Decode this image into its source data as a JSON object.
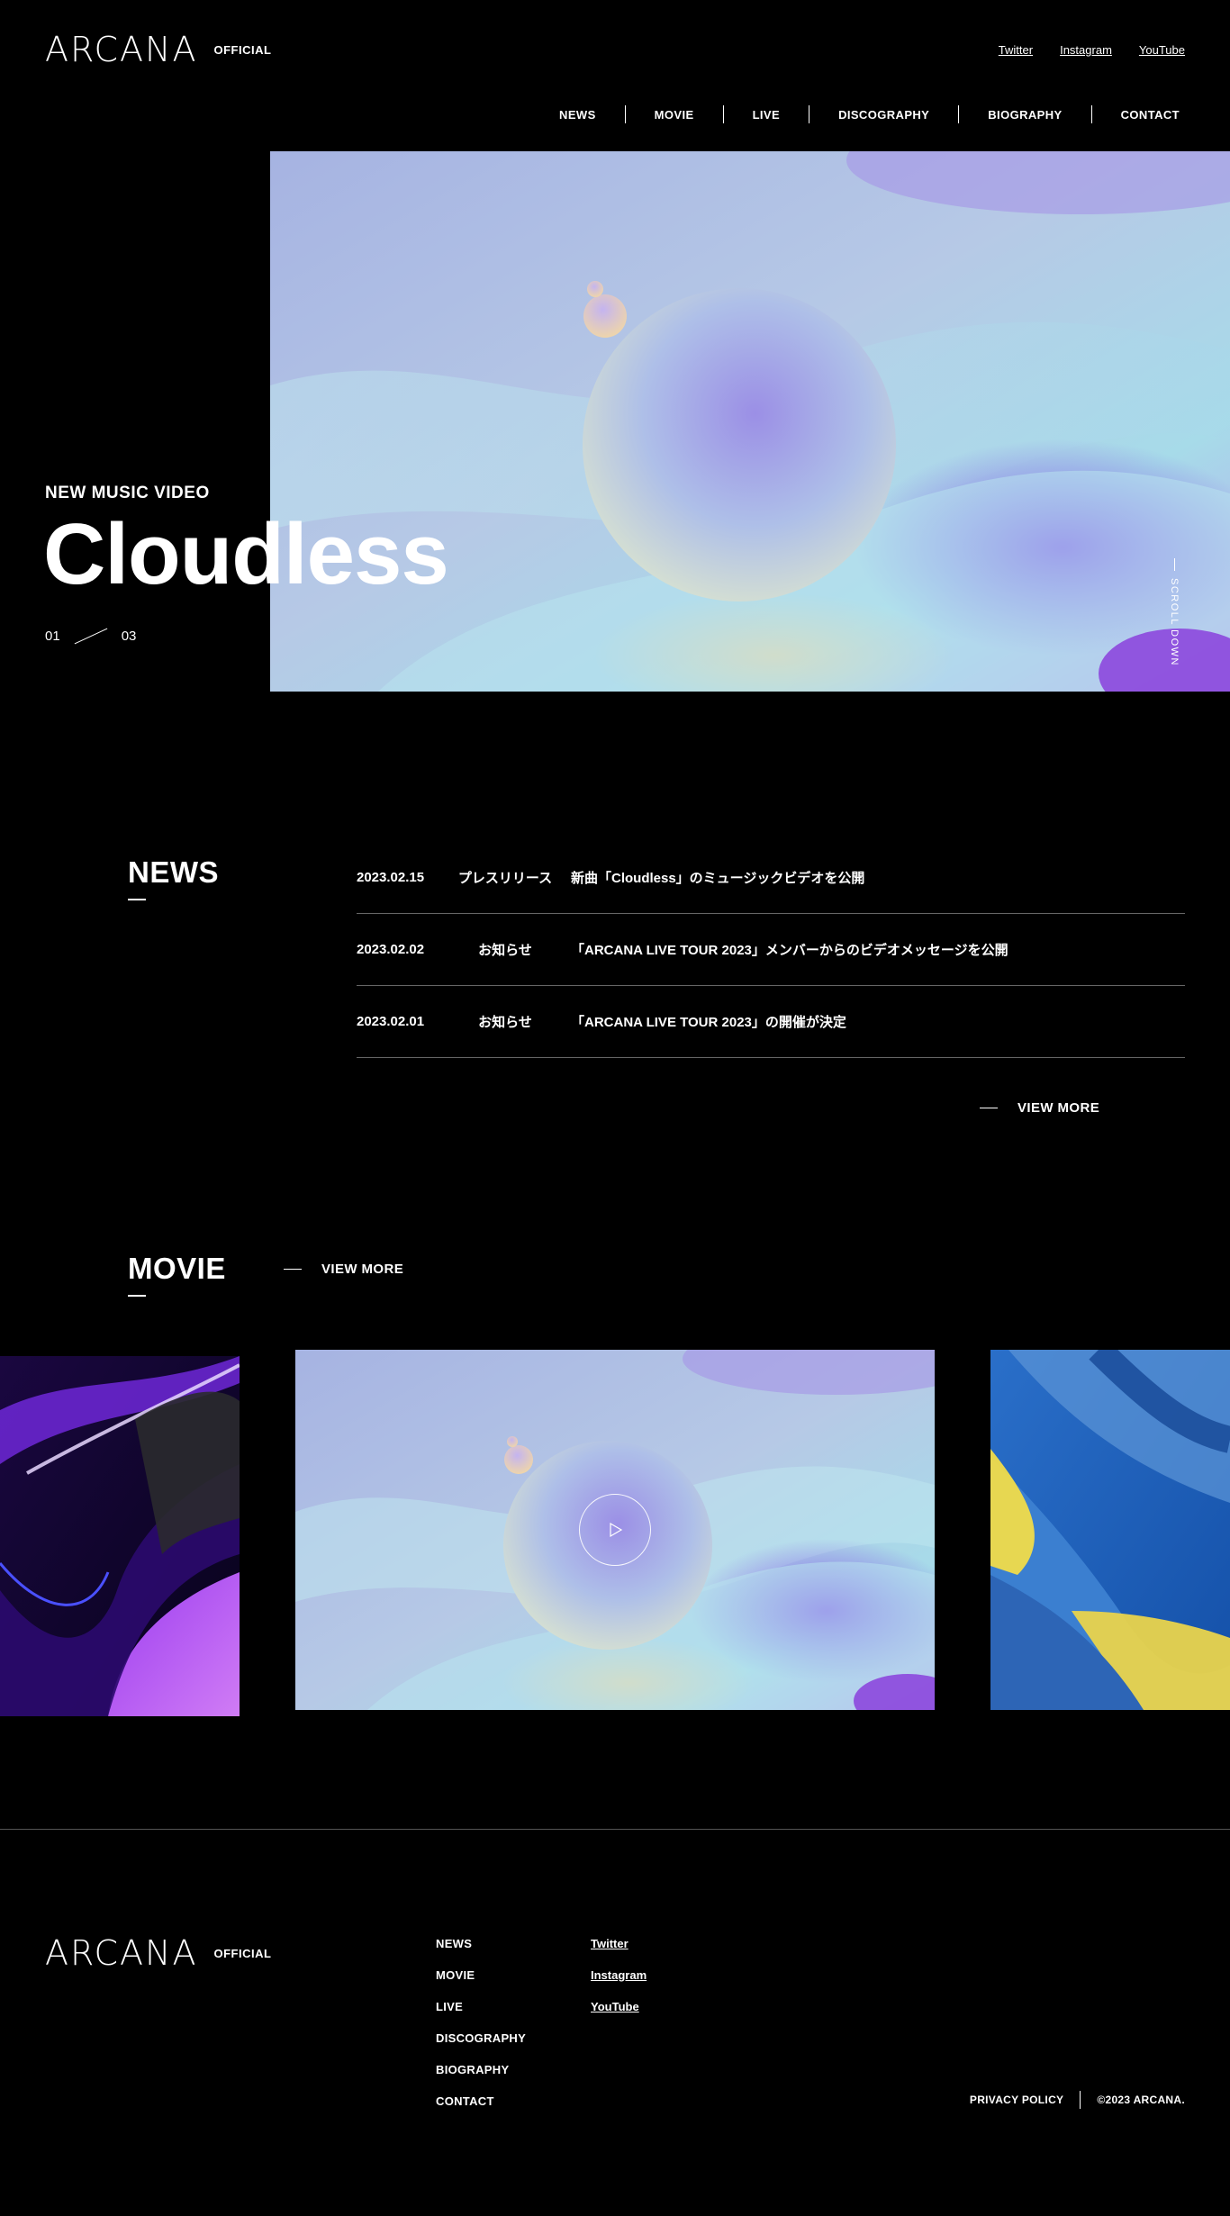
{
  "header": {
    "logo": "ARCANA",
    "logo_tag": "OFFICIAL",
    "social": [
      "Twitter",
      "Instagram",
      "YouTube"
    ],
    "nav": [
      "NEWS",
      "MOVIE",
      "LIVE",
      "DISCOGRAPHY",
      "BIOGRAPHY",
      "CONTACT"
    ]
  },
  "hero": {
    "eyebrow": "NEW MUSIC VIDEO",
    "title": "Cloudless",
    "page_current": "01",
    "page_total": "03",
    "scroll_label": "SCROLL DOWN"
  },
  "news": {
    "heading": "NEWS",
    "items": [
      {
        "date": "2023.02.15",
        "category": "プレスリリース",
        "title": "新曲「Cloudless」のミュージックビデオを公開"
      },
      {
        "date": "2023.02.02",
        "category": "お知らせ",
        "title": "「ARCANA LIVE TOUR 2023」メンバーからのビデオメッセージを公開"
      },
      {
        "date": "2023.02.01",
        "category": "お知らせ",
        "title": "「ARCANA LIVE TOUR 2023」の開催が決定"
      }
    ],
    "view_more": "VIEW MORE"
  },
  "movie": {
    "heading": "MOVIE",
    "view_more": "VIEW MORE",
    "icons": [
      "play-icon"
    ]
  },
  "footer": {
    "logo": "ARCANA",
    "logo_tag": "OFFICIAL",
    "nav": [
      "NEWS",
      "MOVIE",
      "LIVE",
      "DISCOGRAPHY",
      "BIOGRAPHY",
      "CONTACT"
    ],
    "social": [
      "Twitter",
      "Instagram",
      "YouTube"
    ],
    "privacy": "PRIVACY POLICY",
    "copyright": "©2023 ARCANA."
  },
  "colors": {
    "background": "#000000",
    "text": "#ffffff",
    "divider": "#666666",
    "accent_purple": "#8a4fe6",
    "accent_sky": "#a9d9e8"
  }
}
